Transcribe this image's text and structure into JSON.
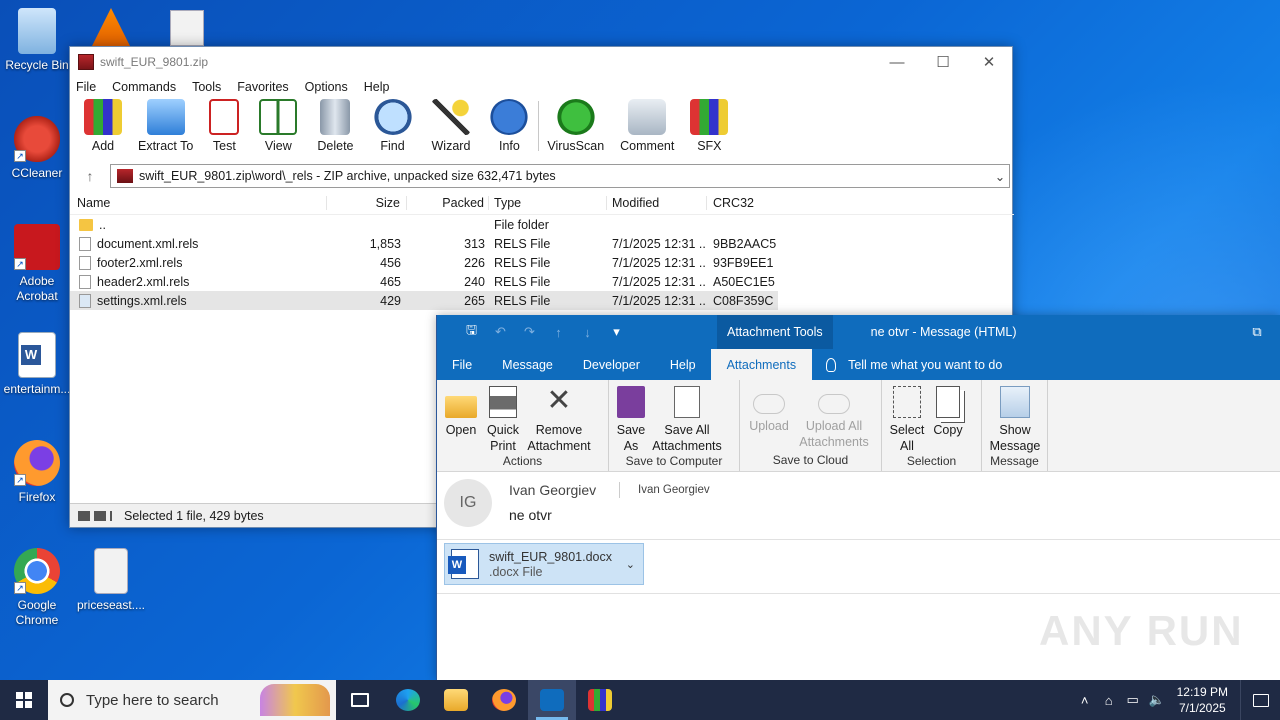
{
  "desktop": {
    "icons": [
      {
        "label": "Recycle Bin",
        "color": "#9ec9f0"
      },
      {
        "label": "CCleaner",
        "color": "#d73b2e"
      },
      {
        "label": "Adobe Acrobat",
        "color": "#d7231e"
      },
      {
        "label": "entertainm...",
        "color": "#2b579a"
      },
      {
        "label": "Firefox",
        "color": "#ff7139"
      },
      {
        "label": "Google Chrome",
        "color": "#4285f4"
      },
      {
        "label": "priceseast....",
        "color": "#e8e8e8"
      }
    ]
  },
  "winrar": {
    "title": "swift_EUR_9801.zip",
    "menu": [
      "File",
      "Commands",
      "Tools",
      "Favorites",
      "Options",
      "Help"
    ],
    "toolbar": [
      "Add",
      "Extract To",
      "Test",
      "View",
      "Delete",
      "Find",
      "Wizard",
      "Info",
      "VirusScan",
      "Comment",
      "SFX"
    ],
    "path": "swift_EUR_9801.zip\\word\\_rels - ZIP archive, unpacked size 632,471 bytes",
    "columns": {
      "name": "Name",
      "size": "Size",
      "packed": "Packed",
      "type": "Type",
      "modified": "Modified",
      "crc": "CRC32"
    },
    "rows": [
      {
        "name": "..",
        "size": "",
        "packed": "",
        "type": "File folder",
        "modified": "",
        "crc": ""
      },
      {
        "name": "document.xml.rels",
        "size": "1,853",
        "packed": "313",
        "type": "RELS File",
        "modified": "7/1/2025 12:31 ...",
        "crc": "9BB2AAC5"
      },
      {
        "name": "footer2.xml.rels",
        "size": "456",
        "packed": "226",
        "type": "RELS File",
        "modified": "7/1/2025 12:31 ...",
        "crc": "93FB9EE1"
      },
      {
        "name": "header2.xml.rels",
        "size": "465",
        "packed": "240",
        "type": "RELS File",
        "modified": "7/1/2025 12:31 ...",
        "crc": "A50EC1E5"
      },
      {
        "name": "settings.xml.rels",
        "size": "429",
        "packed": "265",
        "type": "RELS File",
        "modified": "7/1/2025 12:31 ...",
        "crc": "C08F359C"
      }
    ],
    "status": "Selected 1 file, 429 bytes"
  },
  "outlook": {
    "context_tools": "Attachment Tools",
    "caption": "ne otvr  -  Message (HTML)",
    "tabs": [
      "File",
      "Message",
      "Developer",
      "Help",
      "Attachments"
    ],
    "active_tab": "Attachments",
    "tell_me": "Tell me what you want to do",
    "groups": [
      {
        "label": "Actions",
        "buttons": [
          "Open",
          "Quick Print",
          "Remove Attachment"
        ]
      },
      {
        "label": "Save to Computer",
        "buttons": [
          "Save As",
          "Save All Attachments"
        ]
      },
      {
        "label": "Save to Cloud",
        "buttons": [
          "Upload",
          "Upload All Attachments"
        ]
      },
      {
        "label": "Selection",
        "buttons": [
          "Select All",
          "Copy"
        ]
      },
      {
        "label": "Message",
        "buttons": [
          "Show Message"
        ]
      }
    ],
    "avatar_initials": "IG",
    "from": "Ivan Georgiev",
    "to": "Ivan Georgiev",
    "subject": "ne otvr",
    "attachment": {
      "name": "swift_EUR_9801.docx",
      "type": ".docx File"
    },
    "watermark": "ANY RUN"
  },
  "taskbar": {
    "search_placeholder": "Type here to search",
    "time": "12:19 PM",
    "date": "7/1/2025"
  }
}
